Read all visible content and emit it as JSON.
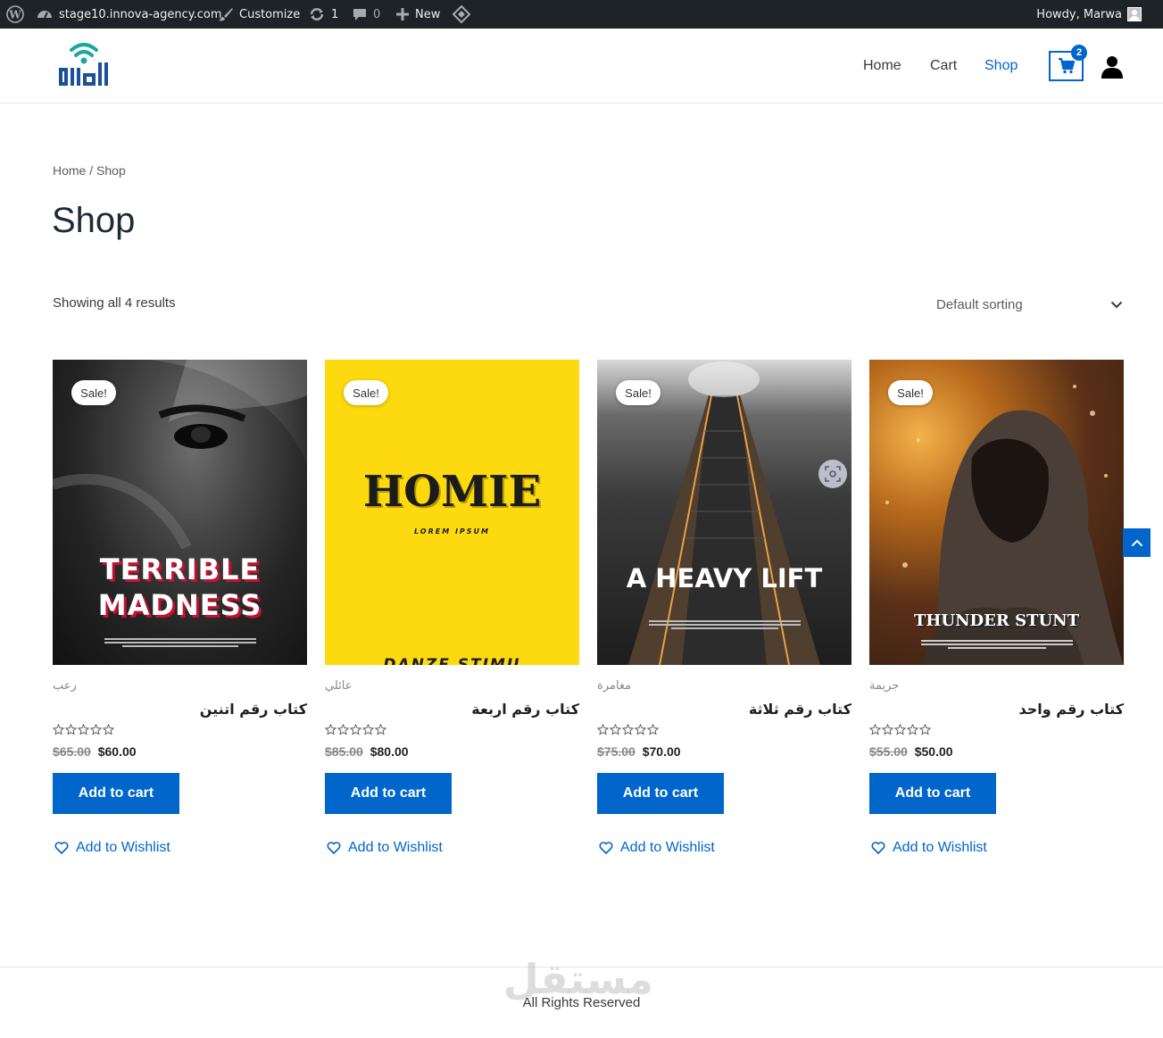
{
  "adminbar": {
    "site": "stage10.innova-agency.com",
    "customize": "Customize",
    "updates_count": "1",
    "comments_count": "0",
    "new_label": "New",
    "howdy": "Howdy, Marwa"
  },
  "header": {
    "nav": {
      "home": "Home",
      "cart": "Cart",
      "shop": "Shop"
    },
    "cart_count": "2",
    "accent_color": "#0066cc"
  },
  "page": {
    "breadcrumb_home": "Home",
    "breadcrumb_separator": " / ",
    "breadcrumb_current": "Shop",
    "title": "Shop",
    "result_count": "Showing all 4 results",
    "sorting": "Default sorting"
  },
  "products": [
    {
      "sale_badge": "Sale!",
      "cover_line1": "TERRIBLE",
      "cover_line2": "MADNESS",
      "category": "رعب",
      "title": "كتاب رقم اتنين",
      "old_price": "$65.00",
      "price": "$60.00",
      "rating": 0,
      "add_to_cart": "Add to cart",
      "wishlist": "Add to Wishlist"
    },
    {
      "sale_badge": "Sale!",
      "cover_line1": "HOMIE",
      "cover_line2": "LOREM IPSUM",
      "cover_line3": "DANZE STIMU",
      "category": "عائلي",
      "title": "كتاب رقم اربعة",
      "old_price": "$85.00",
      "price": "$80.00",
      "rating": 0,
      "add_to_cart": "Add to cart",
      "wishlist": "Add to Wishlist"
    },
    {
      "sale_badge": "Sale!",
      "cover_line1": "A HEAVY LIFT",
      "category": "مغامرة",
      "title": "كتاب رقم ثلاثة",
      "old_price": "$75.00",
      "price": "$70.00",
      "rating": 0,
      "add_to_cart": "Add to cart",
      "wishlist": "Add to Wishlist"
    },
    {
      "sale_badge": "Sale!",
      "cover_line1": "THUNDER STUNT",
      "category": "جريمة",
      "title": "كتاب رقم واحد",
      "old_price": "$55.00",
      "price": "$50.00",
      "rating": 0,
      "add_to_cart": "Add to cart",
      "wishlist": "Add to Wishlist"
    }
  ],
  "footer": {
    "copyright": "All Rights Reserved",
    "watermark": "مستقل"
  }
}
